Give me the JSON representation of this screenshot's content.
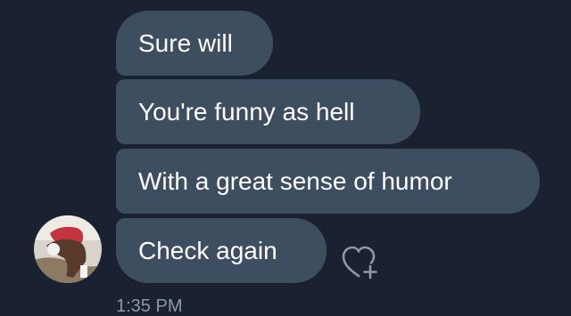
{
  "messages": [
    {
      "text": "Sure will"
    },
    {
      "text": "You're funny as hell"
    },
    {
      "text": "With a great sense of humor"
    },
    {
      "text": "Check again"
    }
  ],
  "timestamp": "1:35 PM",
  "react_icon": "heart-plus-icon",
  "colors": {
    "background": "#1a2231",
    "bubble": "#3d4e61",
    "text": "#ffffff",
    "timestamp": "#8a98a8",
    "icon": "#8a98a8"
  }
}
